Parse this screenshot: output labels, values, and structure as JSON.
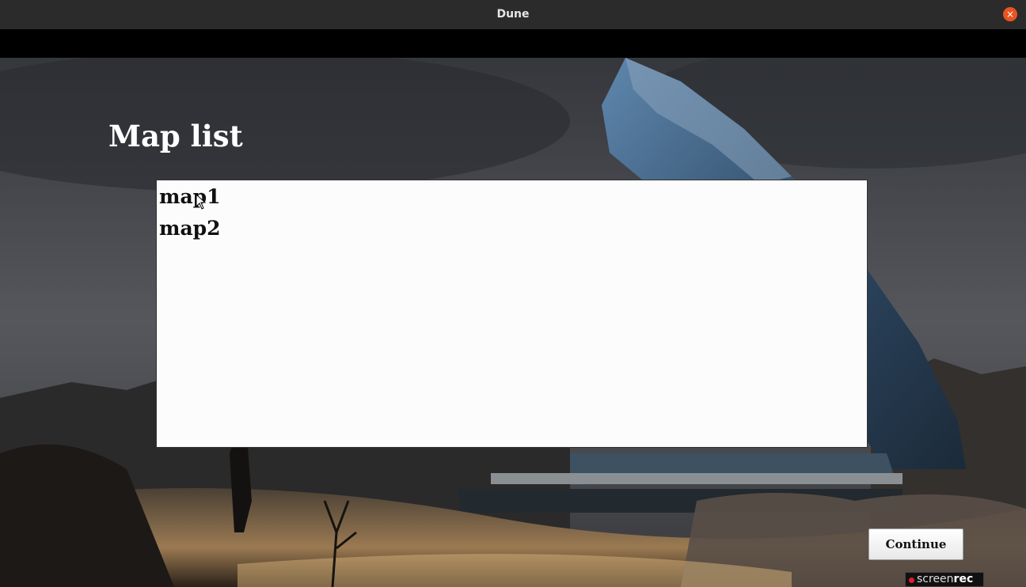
{
  "window": {
    "title": "Dune",
    "close_icon": "×"
  },
  "page": {
    "heading": "Map list"
  },
  "map_list": {
    "items": [
      "map1",
      "map2"
    ]
  },
  "actions": {
    "continue_label": "Continue"
  },
  "watermark": {
    "part1": "screen",
    "part2": "rec"
  },
  "colors": {
    "close_button": "#e95420",
    "titlebar": "#2b2b2b"
  }
}
